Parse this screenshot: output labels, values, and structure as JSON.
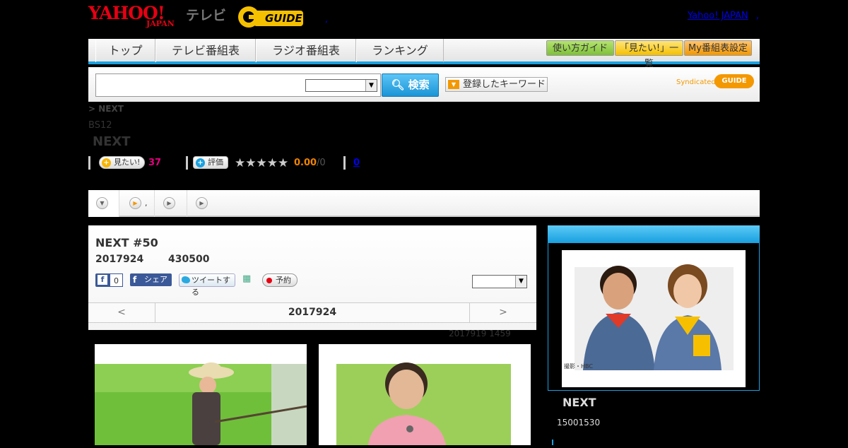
{
  "header": {
    "yahoo_logo": "YAHOO!",
    "japan_logo": "JAPAN",
    "tv_label": "テレビ",
    "gguide_logo": "GUIDE",
    "yahoo_japan_link": "Yahoo! JAPAN",
    "separator": ",",
    "small_dot": ","
  },
  "nav": {
    "tabs": [
      "トップ",
      "テレビ番組表",
      "ラジオ番組表",
      "ランキング"
    ],
    "tool_buttons": [
      "使い方ガイド",
      "「見たい!」一覧",
      "My番組表設定"
    ]
  },
  "search": {
    "input_value": "",
    "select_value": "",
    "button_label": "検索",
    "keyword_button": "登録したキーワード",
    "syndicated": "Syndicated",
    "syndicated_logo": "GUIDE"
  },
  "program": {
    "breadcrumb": "> NEXT",
    "station": "BS12",
    "title": "NEXT",
    "mitai_label": "見たい!",
    "mitai_count": "37",
    "rate_label": "評価",
    "stars": "★★★★★",
    "rating": "0.00",
    "rating_max": "/0",
    "review_count": "0"
  },
  "tabs": {
    "items": [
      "",
      ",",
      "",
      ""
    ]
  },
  "episode": {
    "title": "NEXT #50",
    "date": "2017924",
    "time": "430500",
    "fb_like_count": "0",
    "fb_share": "シェア",
    "tweet": "ツイートする",
    "reserve": "予約",
    "select_value": "",
    "prev": "<",
    "next": ">",
    "nav_date": "2017924",
    "updated": "2017919  1459"
  },
  "sidebar": {
    "header": "",
    "photo_caption": "撮影・HBC",
    "name": "NEXT",
    "time": "15001530"
  },
  "colors": {
    "accent": "#1aa1e0",
    "brand_red": "#e60012",
    "orange": "#f39800"
  }
}
